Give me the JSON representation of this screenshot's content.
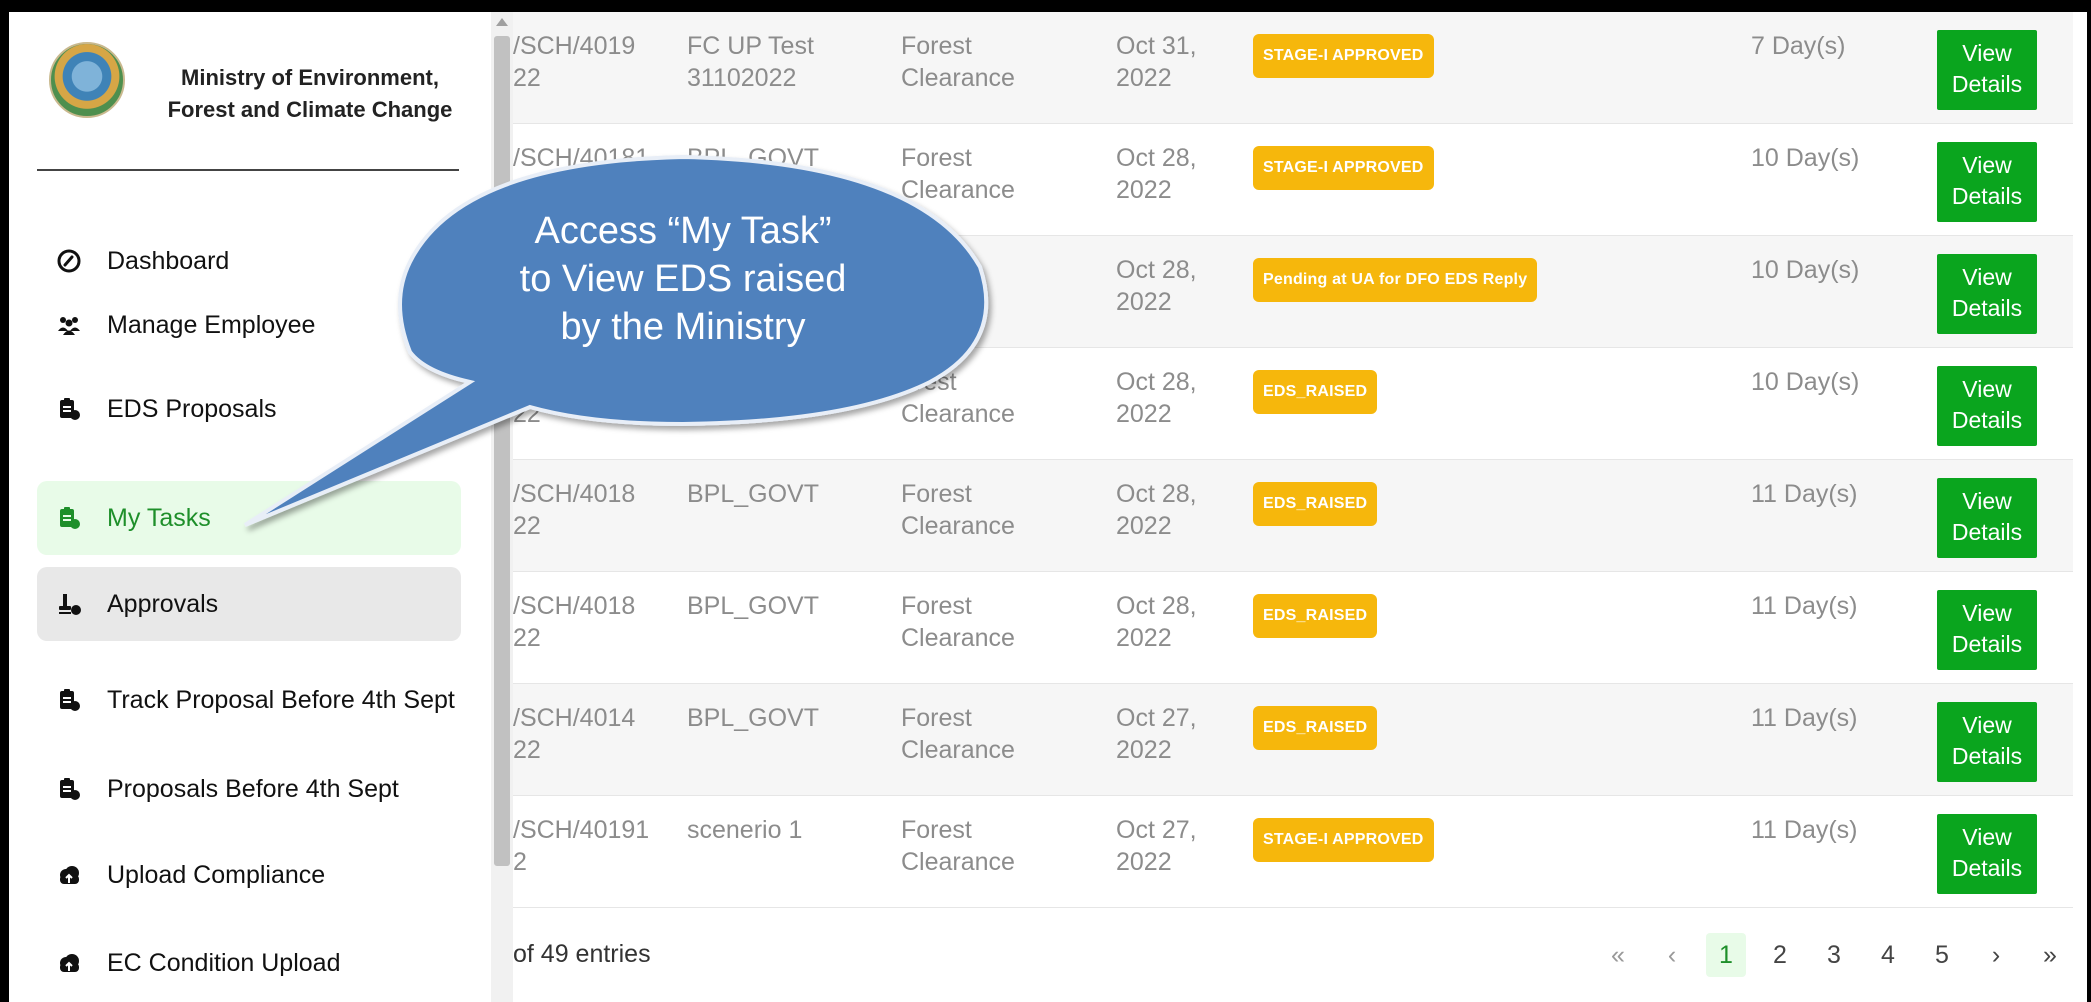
{
  "sidebar": {
    "org_name": "Ministry of Environment, Forest and Climate Change",
    "items": [
      {
        "label": "Dashboard",
        "icon": "gauge-icon"
      },
      {
        "label": "Manage Employee",
        "icon": "people-icon"
      },
      {
        "label": "EDS Proposals",
        "icon": "clipboard-icon"
      },
      {
        "label": "My Tasks",
        "icon": "clipboard-icon",
        "active": true
      },
      {
        "label": "Approvals",
        "icon": "stamp-icon"
      },
      {
        "label": "Track Proposal Before 4th Sept",
        "icon": "clipboard-icon"
      },
      {
        "label": "Proposals Before 4th Sept",
        "icon": "clipboard-icon"
      },
      {
        "label": "Upload Compliance",
        "icon": "cloud-upload-icon"
      },
      {
        "label": "EC Condition Upload",
        "icon": "cloud-upload-icon"
      }
    ]
  },
  "table": {
    "rows": [
      {
        "id": [
          "/SCH/4019",
          "22"
        ],
        "name": [
          "FC UP Test",
          "31102022"
        ],
        "category": [
          "Forest",
          "Clearance"
        ],
        "date": [
          "Oct 31,",
          "2022"
        ],
        "status": "STAGE-I APPROVED",
        "days": "7 Day(s)",
        "action": [
          "View",
          "Details"
        ]
      },
      {
        "id": [
          "/SCH/40181",
          ""
        ],
        "name": [
          "BPL_GOVT",
          ""
        ],
        "category": [
          "Forest",
          "Clearance"
        ],
        "date": [
          "Oct 28,",
          "2022"
        ],
        "status": "STAGE-I APPROVED",
        "days": "10 Day(s)",
        "action": [
          "View",
          "Details"
        ]
      },
      {
        "id": [
          "",
          ""
        ],
        "name": [
          "",
          ""
        ],
        "category": [
          "",
          "ce"
        ],
        "date": [
          "Oct 28,",
          "2022"
        ],
        "status": "Pending at UA for DFO EDS Reply",
        "days": "10 Day(s)",
        "action": [
          "View",
          "Details"
        ]
      },
      {
        "id": [
          "",
          "22"
        ],
        "name": [
          "",
          ""
        ],
        "category": [
          "orest",
          "Clearance"
        ],
        "date": [
          "Oct 28,",
          "2022"
        ],
        "status": "EDS_RAISED",
        "days": "10 Day(s)",
        "action": [
          "View",
          "Details"
        ]
      },
      {
        "id": [
          "/SCH/4018",
          "22"
        ],
        "name": [
          "BPL_GOVT",
          ""
        ],
        "category": [
          "Forest",
          "Clearance"
        ],
        "date": [
          "Oct 28,",
          "2022"
        ],
        "status": "EDS_RAISED",
        "days": "11 Day(s)",
        "action": [
          "View",
          "Details"
        ]
      },
      {
        "id": [
          "/SCH/4018",
          "22"
        ],
        "name": [
          "BPL_GOVT",
          ""
        ],
        "category": [
          "Forest",
          "Clearance"
        ],
        "date": [
          "Oct 28,",
          "2022"
        ],
        "status": "EDS_RAISED",
        "days": "11 Day(s)",
        "action": [
          "View",
          "Details"
        ]
      },
      {
        "id": [
          "/SCH/4014",
          "22"
        ],
        "name": [
          "BPL_GOVT",
          ""
        ],
        "category": [
          "Forest",
          "Clearance"
        ],
        "date": [
          "Oct 27,",
          "2022"
        ],
        "status": "EDS_RAISED",
        "days": "11 Day(s)",
        "action": [
          "View",
          "Details"
        ]
      },
      {
        "id": [
          "/SCH/40191",
          "2"
        ],
        "name": [
          "scenerio 1",
          ""
        ],
        "category": [
          "Forest",
          "Clearance"
        ],
        "date": [
          "Oct 27,",
          "2022"
        ],
        "status": "STAGE-I APPROVED",
        "days": "11 Day(s)",
        "action": [
          "View",
          "Details"
        ]
      }
    ],
    "footer_info": "of 49 entries"
  },
  "pagination": {
    "first": "«",
    "prev": "‹",
    "pages": [
      "1",
      "2",
      "3",
      "4",
      "5"
    ],
    "current": "1",
    "next": "›",
    "last": "»"
  },
  "callout": {
    "lines": [
      "Access “My Task”",
      "to View EDS raised",
      "by the Ministry"
    ]
  },
  "colors": {
    "accent_green": "#0aa51e",
    "active_bg": "#e8fbe8",
    "badge_yellow": "#f6b70c",
    "callout_blue": "#4f81bd"
  }
}
